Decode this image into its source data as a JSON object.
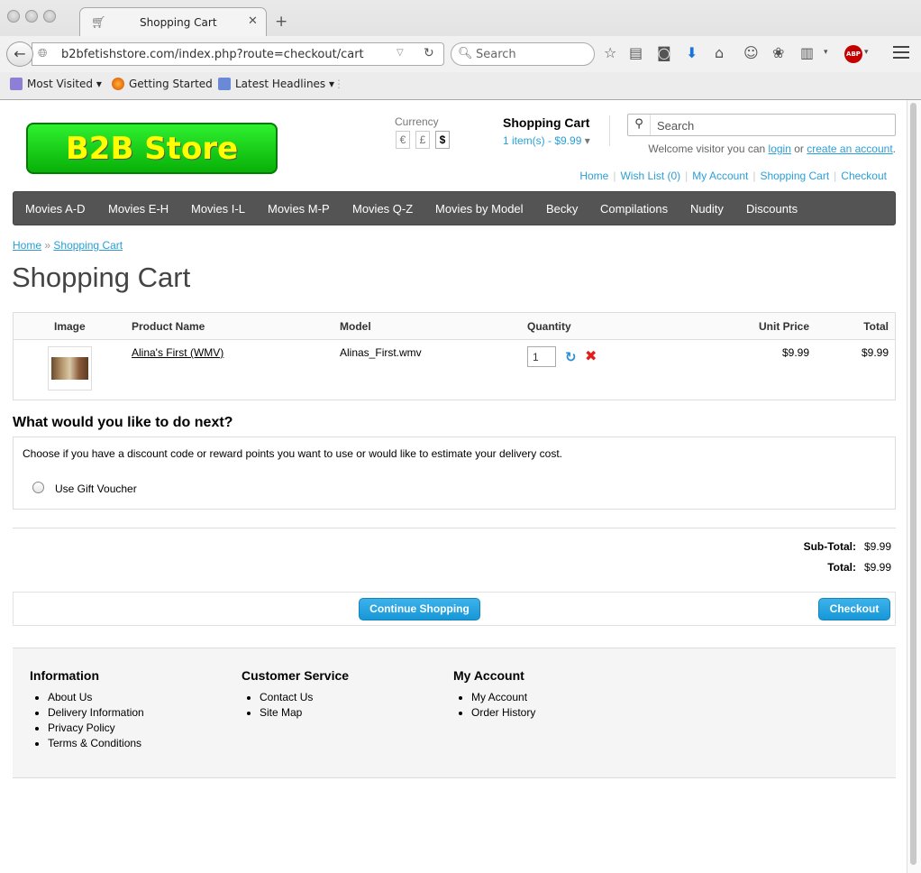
{
  "browser": {
    "tab_title": "Shopping Cart",
    "tab_close": "✕",
    "new_tab": "+",
    "url": "b2bfetishstore.com/index.php?route=checkout/cart",
    "search_placeholder": "Search",
    "abp_label": "ABP",
    "bookmarks": [
      "Most Visited",
      "Getting Started",
      "Latest Headlines"
    ]
  },
  "store": {
    "logo_text": "B2B Store",
    "currency_label": "Currency",
    "currencies": [
      "€",
      "£",
      "$"
    ],
    "cart_title": "Shopping Cart",
    "cart_summary": "1 item(s) - $9.99",
    "search_placeholder": "Search",
    "welcome_prefix": "Welcome visitor you can",
    "login_link": "login",
    "welcome_or": "or",
    "create_account_link": "create an account",
    "welcome_suffix": "."
  },
  "top_links": [
    "Home",
    "Wish List (0)",
    "My Account",
    "Shopping Cart",
    "Checkout"
  ],
  "menu": [
    "Movies A-D",
    "Movies E-H",
    "Movies I-L",
    "Movies M-P",
    "Movies Q-Z",
    "Movies by Model",
    "Becky",
    "Compilations",
    "Nudity",
    "Discounts"
  ],
  "breadcrumb": {
    "home": "Home",
    "sep": "»",
    "current": "Shopping Cart"
  },
  "page_title": "Shopping Cart",
  "cart_table": {
    "headers": [
      "Image",
      "Product Name",
      "Model",
      "Quantity",
      "Unit Price",
      "Total"
    ],
    "rows": [
      {
        "name": "Alina's First (WMV)",
        "model": "Alinas_First.wmv",
        "quantity": "1",
        "unit_price": "$9.99",
        "total": "$9.99"
      }
    ]
  },
  "next": {
    "title": "What would you like to do next?",
    "description": "Choose if you have a discount code or reward points you want to use or would like to estimate your delivery cost.",
    "option": "Use Gift Voucher"
  },
  "totals": [
    {
      "label": "Sub-Total:",
      "value": "$9.99"
    },
    {
      "label": "Total:",
      "value": "$9.99"
    }
  ],
  "buttons": {
    "continue": "Continue Shopping",
    "checkout": "Checkout"
  },
  "footer": {
    "information": {
      "title": "Information",
      "items": [
        "About Us",
        "Delivery Information",
        "Privacy Policy",
        "Terms & Conditions"
      ]
    },
    "customer_service": {
      "title": "Customer Service",
      "items": [
        "Contact Us",
        "Site Map"
      ]
    },
    "my_account": {
      "title": "My Account",
      "items": [
        "My Account",
        "Order History"
      ]
    }
  },
  "colors": {
    "link": "#2a9fd6",
    "menu_bg": "#545454",
    "button": "#1797d8",
    "logo_green": "#08b008",
    "logo_text": "#ffff00"
  }
}
